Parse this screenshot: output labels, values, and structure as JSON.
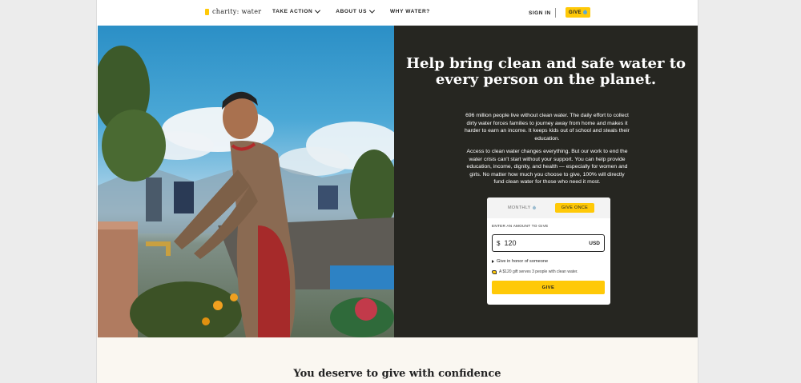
{
  "header": {
    "logo_text": "charity: water",
    "nav": [
      {
        "label": "TAKE ACTION",
        "has_dropdown": true
      },
      {
        "label": "ABOUT US",
        "has_dropdown": true
      },
      {
        "label": "WHY WATER?",
        "has_dropdown": false
      }
    ],
    "signin_label": "SIGN IN",
    "give_label": "GIVE"
  },
  "hero": {
    "headline": "Help bring clean and safe water to every person on the planet.",
    "paragraph_1": "696 million people live without clean water. The daily effort to collect dirty water forces families to journey away from home and makes it harder to earn an income. It keeps kids out of school and steals their education.",
    "paragraph_2": "Access to clean water changes everything. But our work to end the water crisis can't start without your support. You can help provide education, income, dignity, and health — especially for women and girls. No matter how much you choose to give, 100% will directly fund clean water for those who need it most."
  },
  "donation_form": {
    "tab_monthly": "MONTHLY",
    "tab_once": "GIVE ONCE",
    "selected_tab": "GIVE ONCE",
    "amount_label": "ENTER AN AMOUNT TO GIVE",
    "currency_symbol": "$",
    "amount_value": "120",
    "currency_code": "USD",
    "honor_label": "Give in honor of someone",
    "impact_text": "A $120 gift serves 3 people with clean water.",
    "submit_label": "GIVE"
  },
  "lower_section": {
    "heading": "You deserve to give with confidence"
  },
  "colors": {
    "brand_yellow": "#ffc907",
    "hero_dark": "#262621",
    "lower_bg": "#faf7f1"
  }
}
